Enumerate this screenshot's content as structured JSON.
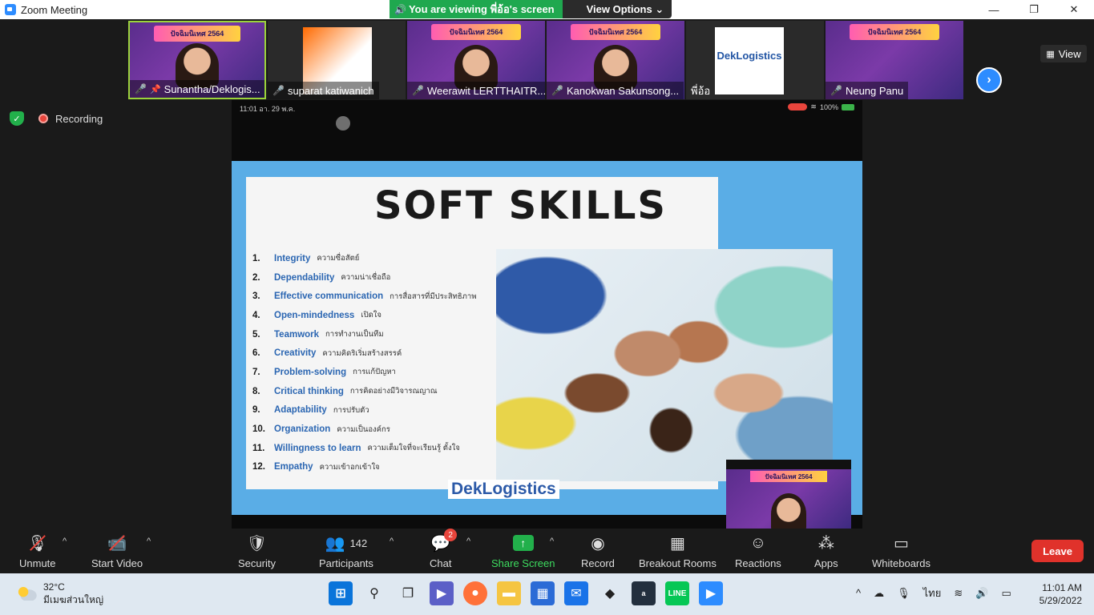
{
  "window": {
    "title": "Zoom Meeting",
    "minimize": "—",
    "restore": "❐",
    "close": "✕"
  },
  "banner": {
    "viewing": "You are viewing พี่อ้อ's screen",
    "view_options": "View Options ⌄"
  },
  "participants_strip": [
    {
      "name": "Sunantha/Deklogis...",
      "active": true
    },
    {
      "name": "suparat katiwanich"
    },
    {
      "name": "Weerawit LERTTHAITR..."
    },
    {
      "name": "Kanokwan Sakunsong..."
    },
    {
      "name": "พี่อ้อ",
      "logo": "DekLogistics"
    },
    {
      "name": "Neung Panu"
    }
  ],
  "thumb_banner_text": "ปัจฉิมนิเทศ 2564",
  "view_button": "View",
  "recording_label": "Recording",
  "phone_status": {
    "time": "11:01 อา. 29 พ.ค.",
    "battery": "100%"
  },
  "slide": {
    "title": "SOFT SKILLS",
    "skills": [
      {
        "num": "1.",
        "en": "Integrity",
        "th": "ความซื่อสัตย์"
      },
      {
        "num": "2.",
        "en": "Dependability",
        "th": "ความน่าเชื่อถือ"
      },
      {
        "num": "3.",
        "en": "Effective communication",
        "th": "การสื่อสารที่มีประสิทธิภาพ"
      },
      {
        "num": "4.",
        "en": "Open-mindedness",
        "th": "เปิดใจ"
      },
      {
        "num": "5.",
        "en": "Teamwork",
        "th": "การทำงานเป็นทีม"
      },
      {
        "num": "6.",
        "en": "Creativity",
        "th": "ความคิดริเริ่มสร้างสรรค์"
      },
      {
        "num": "7.",
        "en": "Problem-solving",
        "th": "การแก้ปัญหา"
      },
      {
        "num": "8.",
        "en": "Critical thinking",
        "th": "การคิดอย่างมีวิจารณญาณ"
      },
      {
        "num": "9.",
        "en": "Adaptability",
        "th": "การปรับตัว"
      },
      {
        "num": "10.",
        "en": "Organization",
        "th": "ความเป็นองค์กร"
      },
      {
        "num": "11.",
        "en": "Willingness to learn",
        "th": "ความเต็มใจที่จะเรียนรู้ ตั้งใจ"
      },
      {
        "num": "12.",
        "en": "Empathy",
        "th": "ความเข้าอกเข้าใจ"
      }
    ],
    "logo": "DekLogistics"
  },
  "toolbar": {
    "unmute": "Unmute",
    "start_video": "Start Video",
    "security": "Security",
    "participants": "Participants",
    "participants_count": "142",
    "chat": "Chat",
    "chat_badge": "2",
    "share_screen": "Share Screen",
    "record": "Record",
    "breakout_rooms": "Breakout Rooms",
    "reactions": "Reactions",
    "apps": "Apps",
    "whiteboards": "Whiteboards",
    "leave": "Leave"
  },
  "taskbar": {
    "temperature": "32°C",
    "weather_desc": "มีเมฆส่วนใหญ่",
    "language": "ไทย",
    "time": "11:01 AM",
    "date": "5/29/2022"
  }
}
